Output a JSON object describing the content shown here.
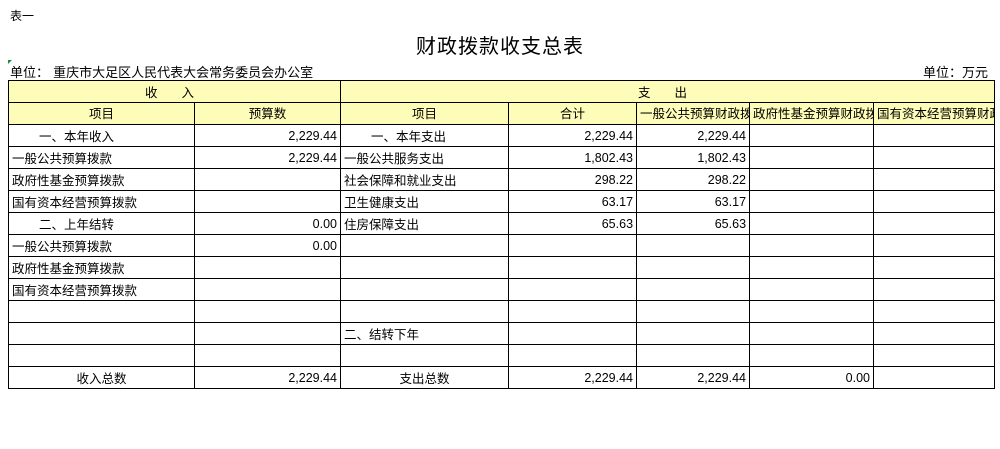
{
  "header": {
    "table_no": "表一",
    "title": "财政拨款收支总表",
    "unit_left": "单位：  重庆市大足区人民代表大会常务委员会办公室",
    "unit_right": "单位：万元"
  },
  "colors": {
    "header_fill": "#fdfcb8",
    "border": "#000000",
    "corner_mark": "#1a8f3a"
  },
  "columns": {
    "income_group": "收 入",
    "expense_group": "支 出",
    "income_item": "项目",
    "income_budget": "预算数",
    "expense_item": "项目",
    "expense_total": "合计",
    "expense_general": "一般公共预算财政拨款",
    "expense_fund": "政府性基金预算财政拨款",
    "expense_capital": "国有资本经营预算财政拨款"
  },
  "rows": [
    [
      "一、本年收入",
      "2,229.44",
      "一、本年支出",
      "2,229.44",
      "2,229.44",
      "",
      ""
    ],
    [
      "一般公共预算拨款",
      "2,229.44",
      "一般公共服务支出",
      "1,802.43",
      "1,802.43",
      "",
      ""
    ],
    [
      "政府性基金预算拨款",
      "",
      "社会保障和就业支出",
      "298.22",
      "298.22",
      "",
      ""
    ],
    [
      "国有资本经营预算拨款",
      "",
      "卫生健康支出",
      "63.17",
      "63.17",
      "",
      ""
    ],
    [
      "二、上年结转",
      "0.00",
      "住房保障支出",
      "65.63",
      "65.63",
      "",
      ""
    ],
    [
      "一般公共预算拨款",
      "0.00",
      "",
      "",
      "",
      "",
      ""
    ],
    [
      "政府性基金预算拨款",
      "",
      "",
      "",
      "",
      "",
      ""
    ],
    [
      "国有资本经营预算拨款",
      "",
      "",
      "",
      "",
      "",
      ""
    ],
    [
      "",
      "",
      "",
      "",
      "",
      "",
      ""
    ],
    [
      "",
      "",
      "二、结转下年",
      "",
      "",
      "",
      ""
    ],
    [
      "",
      "",
      "",
      "",
      "",
      "",
      ""
    ]
  ],
  "totals": {
    "income_label": "收入总数",
    "income_value": "2,229.44",
    "expense_label": "支出总数",
    "expense_total": "2,229.44",
    "expense_general": "2,229.44",
    "expense_fund": "0.00",
    "expense_capital": ""
  }
}
